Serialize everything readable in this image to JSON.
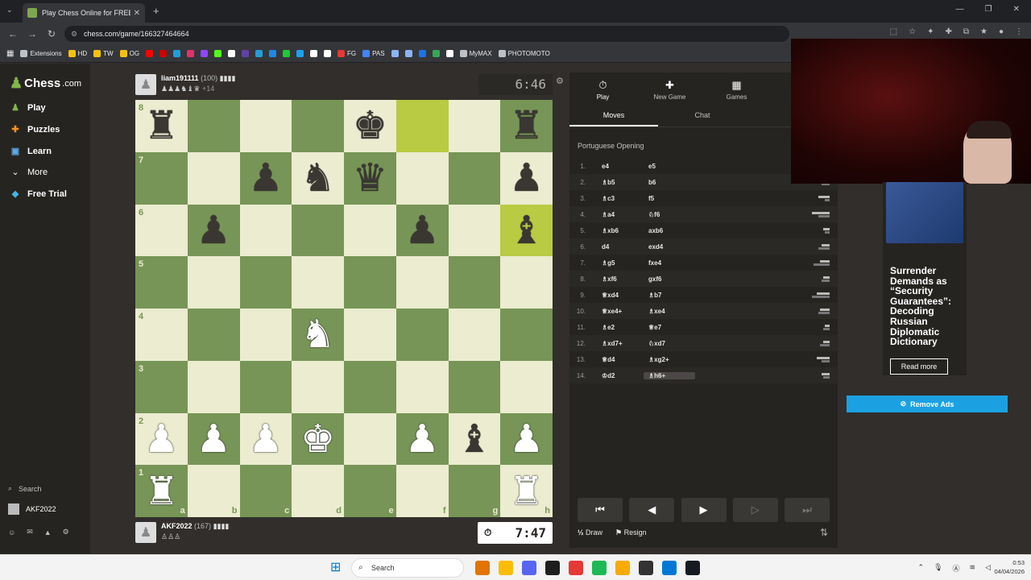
{
  "browser": {
    "tab_title": "Play Chess Online for FREE - 2 Pl",
    "url": "chess.com/game/166327464664",
    "bookmarks": [
      {
        "label": "Extensions",
        "color": "#bdc1c6"
      },
      {
        "label": "HD",
        "color": "#f4c20d"
      },
      {
        "label": "TW",
        "color": "#f4c20d"
      },
      {
        "label": "OG",
        "color": "#f4c20d"
      },
      {
        "label": "",
        "color": "#ff0000"
      },
      {
        "label": "",
        "color": "#cc0000"
      },
      {
        "label": "",
        "color": "#229ed9"
      },
      {
        "label": "",
        "color": "#e1306c"
      },
      {
        "label": "",
        "color": "#9146ff"
      },
      {
        "label": "",
        "color": "#53fc18"
      },
      {
        "label": "",
        "color": "#ffffff"
      },
      {
        "label": "",
        "color": "#6441a5"
      },
      {
        "label": "",
        "color": "#229ed9"
      },
      {
        "label": "",
        "color": "#1e88e5"
      },
      {
        "label": "",
        "color": "#20c933"
      },
      {
        "label": "",
        "color": "#1da1f2"
      },
      {
        "label": "",
        "color": "#ffffff"
      },
      {
        "label": "",
        "color": "#ffffff"
      },
      {
        "label": "FG",
        "color": "#e53935"
      },
      {
        "label": "PAS",
        "color": "#4285f4"
      },
      {
        "label": "",
        "color": "#8ab4f8"
      },
      {
        "label": "",
        "color": "#8ab4f8"
      },
      {
        "label": "",
        "color": "#1a73e8"
      },
      {
        "label": "",
        "color": "#34a853"
      },
      {
        "label": "",
        "color": "#ffffff"
      },
      {
        "label": "MyMAX",
        "color": "#bdc1c6"
      },
      {
        "label": "PHOTOMOTO",
        "color": "#bdc1c6"
      }
    ]
  },
  "sidebar": {
    "logo": "Chess",
    "logo_suffix": ".com",
    "items": [
      {
        "label": "Play",
        "icon": "play-icon",
        "color": "#81b64c"
      },
      {
        "label": "Puzzles",
        "icon": "puzzle-icon",
        "color": "#f7931a"
      },
      {
        "label": "Learn",
        "icon": "learn-icon",
        "color": "#5da9e9"
      },
      {
        "label": "More",
        "icon": "chevron-down-icon",
        "color": "#ffffff"
      },
      {
        "label": "Free Trial",
        "icon": "diamond-icon",
        "color": "#41b6e6"
      }
    ],
    "search_label": "Search",
    "user_label": "AKF2022"
  },
  "top_player": {
    "name": "liam191111",
    "rating": "(100)",
    "captured": "♟♟♟♞♝♛",
    "advantage": "+14",
    "clock": "6:46"
  },
  "bottom_player": {
    "name": "AKF2022",
    "rating": "(167)",
    "captured": "♙♙♙",
    "clock": "7:47"
  },
  "board": {
    "ranks": [
      "8",
      "7",
      "6",
      "5",
      "4",
      "3",
      "2",
      "1"
    ],
    "files": [
      "a",
      "b",
      "c",
      "d",
      "e",
      "f",
      "g",
      "h"
    ],
    "position": [
      [
        "r",
        "",
        "",
        "",
        "k",
        "",
        "",
        "r"
      ],
      [
        "",
        "",
        "p",
        "n",
        "q",
        "",
        "",
        "p"
      ],
      [
        "",
        "p",
        "",
        "",
        "",
        "p",
        "",
        "b"
      ],
      [
        "",
        "",
        "",
        "",
        "",
        "",
        "",
        ""
      ],
      [
        "",
        "",
        "",
        "N",
        "",
        "",
        "",
        ""
      ],
      [
        "",
        "",
        "",
        "",
        "",
        "",
        "",
        ""
      ],
      [
        "P",
        "P",
        "P",
        "K",
        "",
        "P",
        "b",
        "P"
      ],
      [
        "R",
        "",
        "",
        "",
        "",
        "",
        "",
        "R"
      ]
    ],
    "highlights": [
      "f8",
      "h6"
    ]
  },
  "panel": {
    "tabs": [
      {
        "label": "Play",
        "icon": "clock-icon"
      },
      {
        "label": "New Game",
        "icon": "plus-icon"
      },
      {
        "label": "Games",
        "icon": "board-icon"
      }
    ],
    "subtabs": [
      "Moves",
      "Chat"
    ],
    "opening": "Portuguese Opening",
    "moves": [
      {
        "n": "1.",
        "w": "e4",
        "b": "e5"
      },
      {
        "n": "2.",
        "w": "♗b5",
        "b": "b6"
      },
      {
        "n": "3.",
        "w": "♗c3",
        "b": "f5"
      },
      {
        "n": "4.",
        "w": "♗a4",
        "b": "♘f6"
      },
      {
        "n": "5.",
        "w": "♗xb6",
        "b": "axb6"
      },
      {
        "n": "6.",
        "w": "d4",
        "b": "exd4"
      },
      {
        "n": "7.",
        "w": "♗g5",
        "b": "fxe4"
      },
      {
        "n": "8.",
        "w": "♗xf6",
        "b": "gxf6"
      },
      {
        "n": "9.",
        "w": "♕xd4",
        "b": "♗b7"
      },
      {
        "n": "10.",
        "w": "♕xe4+",
        "b": "♗xe4"
      },
      {
        "n": "11.",
        "w": "♗e2",
        "b": "♕e7"
      },
      {
        "n": "12.",
        "w": "♗xd7+",
        "b": "♘xd7"
      },
      {
        "n": "13.",
        "w": "♕d4",
        "b": "♗xg2+"
      },
      {
        "n": "14.",
        "w": "♔d2",
        "b": "♗h6+"
      }
    ],
    "draw_label": "Draw",
    "resign_label": "Resign",
    "draw_icon": "½"
  },
  "ad": {
    "headline": "Surrender Demands as “Security Guarantees”: Decoding Russian Diplomatic Dictionary",
    "read_more": "Read more",
    "remove_ads": "Remove Ads"
  },
  "taskbar": {
    "search_placeholder": "Search",
    "time": "0:53",
    "date": "04/04/2026",
    "apps": [
      "#e37400",
      "#fbbc04",
      "#5865f2",
      "#1e1e1e",
      "#e53935",
      "#1db954",
      "#f9ab00",
      "#333333",
      "#0078d4",
      "#171a21"
    ]
  }
}
